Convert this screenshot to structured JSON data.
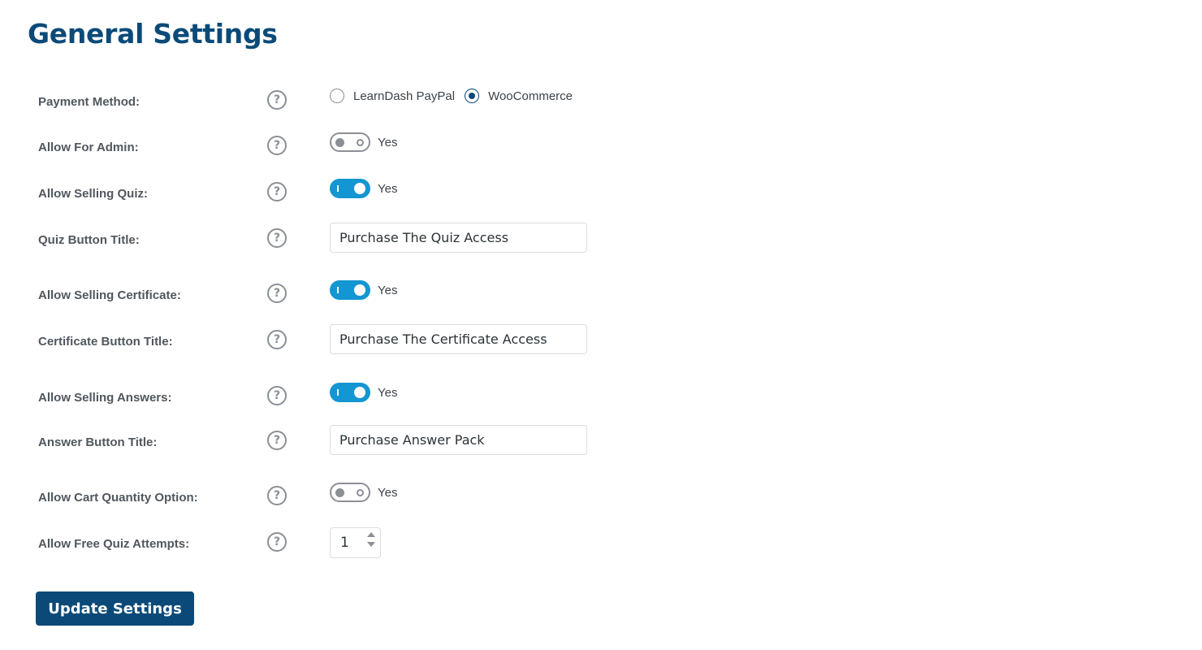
{
  "page": {
    "title": "General Settings"
  },
  "help_icon_glyph": "?",
  "settings": {
    "payment_method": {
      "label": "Payment Method:",
      "options": [
        {
          "label": "LearnDash PayPal",
          "checked": false
        },
        {
          "label": "WooCommerce",
          "checked": true
        }
      ]
    },
    "allow_for_admin": {
      "label": "Allow For Admin:",
      "toggle_text": "Yes",
      "enabled": false
    },
    "allow_selling_quiz": {
      "label": "Allow Selling Quiz:",
      "toggle_text": "Yes",
      "enabled": true
    },
    "quiz_button_title": {
      "label": "Quiz Button Title:",
      "value": "Purchase The Quiz Access"
    },
    "allow_selling_certificate": {
      "label": "Allow Selling Certificate:",
      "toggle_text": "Yes",
      "enabled": true
    },
    "certificate_button_title": {
      "label": "Certificate Button Title:",
      "value": "Purchase The Certificate Access"
    },
    "allow_selling_answers": {
      "label": "Allow Selling Answers:",
      "toggle_text": "Yes",
      "enabled": true
    },
    "answer_button_title": {
      "label": "Answer Button Title:",
      "value": "Purchase Answer Pack"
    },
    "allow_cart_quantity": {
      "label": "Allow Cart Quantity Option:",
      "toggle_text": "Yes",
      "enabled": false
    },
    "free_quiz_attempts": {
      "label": "Allow Free Quiz Attempts:",
      "value": "1"
    }
  },
  "actions": {
    "update_label": "Update Settings"
  },
  "colors": {
    "accent": "#0b4a78",
    "toggle_on": "#1396d1",
    "toggle_off": "#8c8f94"
  }
}
